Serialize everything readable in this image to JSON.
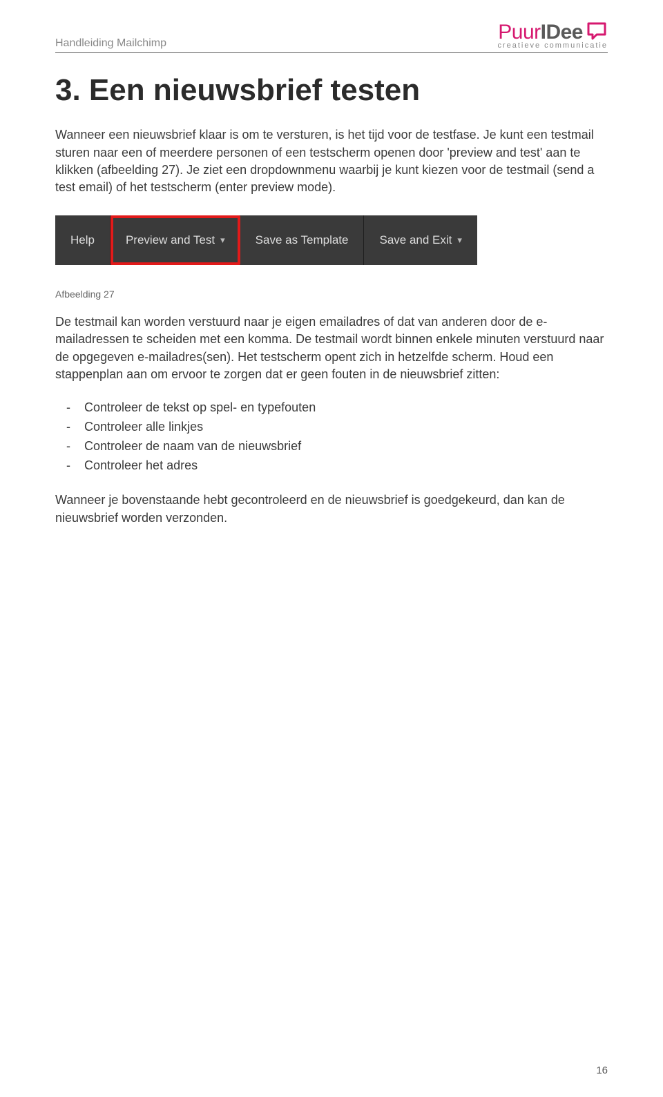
{
  "header": {
    "title": "Handleiding Mailchimp"
  },
  "logo": {
    "part1": "Puur",
    "part2": "IDee",
    "tagline": "creatieve communicatie"
  },
  "heading": "3. Een nieuwsbrief testen",
  "intro": "Wanneer een nieuwsbrief klaar is om te versturen, is het tijd voor de testfase. Je kunt een testmail sturen naar een of meerdere personen of een testscherm openen door 'preview and test' aan te klikken (afbeelding 27). Je ziet een dropdownmenu waarbij je kunt kiezen voor de testmail (send a test email) of het testscherm (enter preview mode).",
  "toolbar": {
    "help": "Help",
    "preview": "Preview and Test",
    "save_template": "Save as Template",
    "save_exit": "Save and Exit"
  },
  "caption": "Afbeelding 27",
  "para2": "De testmail kan worden verstuurd naar je eigen emailadres of dat van anderen door de e-mailadressen te scheiden met een komma. De testmail wordt binnen enkele minuten verstuurd naar de opgegeven e-mailadres(sen). Het testscherm opent zich in hetzelfde scherm. Houd een stappenplan aan om ervoor te zorgen dat er geen fouten in de nieuwsbrief zitten:",
  "checklist": {
    "item1": "Controleer de tekst op spel- en typefouten",
    "item2": "Controleer alle linkjes",
    "item3": "Controleer de naam van de nieuwsbrief",
    "item4": "Controleer het adres"
  },
  "para3": "Wanneer je bovenstaande hebt gecontroleerd en de nieuwsbrief is goedgekeurd, dan kan de nieuwsbrief worden verzonden.",
  "page_number": "16"
}
